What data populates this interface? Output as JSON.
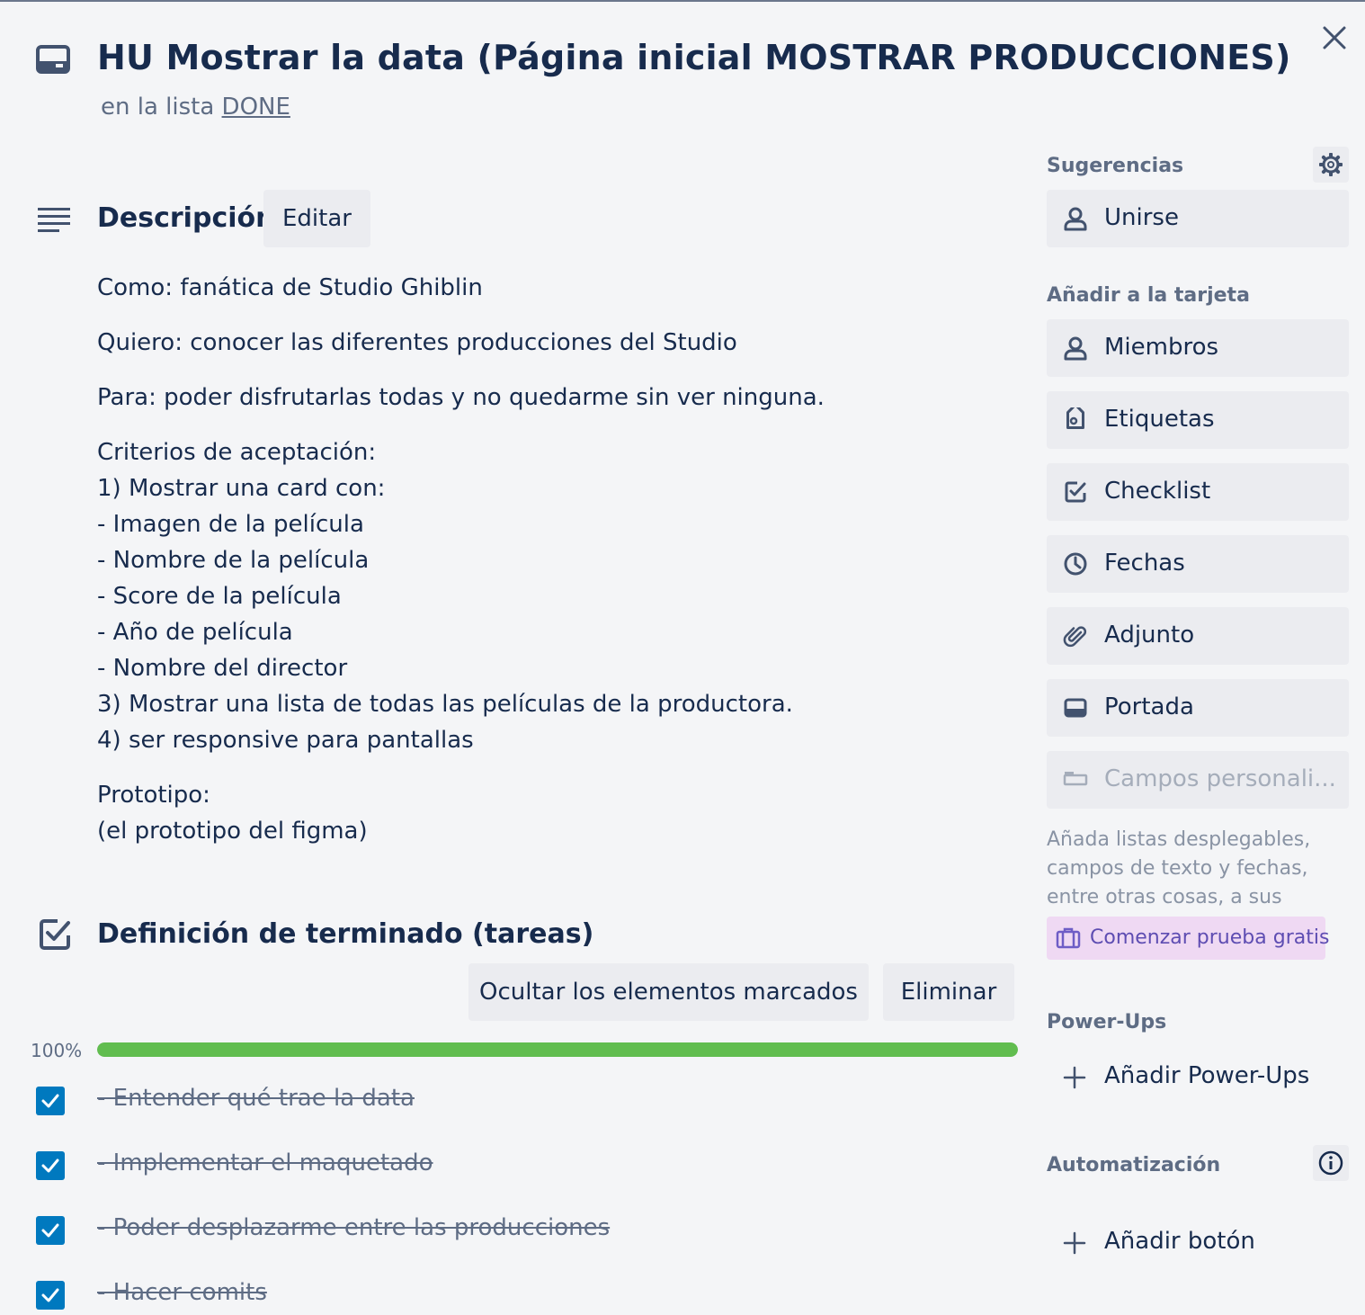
{
  "card": {
    "title": "HU Mostrar la data (Página inicial MOSTRAR PRODUCCIONES)",
    "list_prefix": "en la lista",
    "list_name": "DONE"
  },
  "description": {
    "heading": "Descripción",
    "edit_label": "Editar",
    "lines": {
      "como": "Como: fanática de Studio Ghiblin",
      "quiero": "Quiero: conocer las diferentes producciones del Studio",
      "para": "Para: poder disfrutarlas todas y no quedarme sin ver ninguna.",
      "criterios": [
        "Criterios de aceptación:",
        "1) Mostrar una card con:",
        "- Imagen de la película",
        "- Nombre de la película",
        "- Score de la película",
        "- Año de película",
        "- Nombre del director",
        "3) Mostrar una lista de todas las películas de la productora.",
        "4) ser responsive para pantallas"
      ],
      "prototipo": [
        "Prototipo:",
        "(el prototipo del figma)"
      ]
    }
  },
  "checklist": {
    "heading": "Definición de terminado (tareas)",
    "hide_label": "Ocultar los elementos marcados",
    "delete_label": "Eliminar",
    "progress_label": "100%",
    "progress_fraction": 1.0,
    "items": [
      {
        "text": "- Entender qué trae la data",
        "checked": true
      },
      {
        "text": "- Implementar el maquetado",
        "checked": true
      },
      {
        "text": "- Poder desplazarme entre las producciones",
        "checked": true
      },
      {
        "text": "- Hacer comits",
        "checked": true
      }
    ]
  },
  "sidebar": {
    "suggestions_label": "Sugerencias",
    "join_label": "Unirse",
    "add_to_card_label": "Añadir a la tarjeta",
    "buttons": {
      "members": "Miembros",
      "labels": "Etiquetas",
      "checklist": "Checklist",
      "dates": "Fechas",
      "attachment": "Adjunto",
      "cover": "Portada",
      "custom_fields": "Campos personali..."
    },
    "custom_fields_help": "Añada listas desplegables, campos de texto y fechas, entre otras cosas, a sus tarjetas.",
    "trial_label": "Comenzar prueba gratis",
    "powerups_label": "Power-Ups",
    "add_powerups_label": "Añadir Power-Ups",
    "automation_label": "Automatización",
    "add_button_label": "Añadir botón"
  },
  "colors": {
    "progress": "#61bd4f",
    "checkbox": "#0079bf",
    "trial_bg": "#efd9f3"
  }
}
